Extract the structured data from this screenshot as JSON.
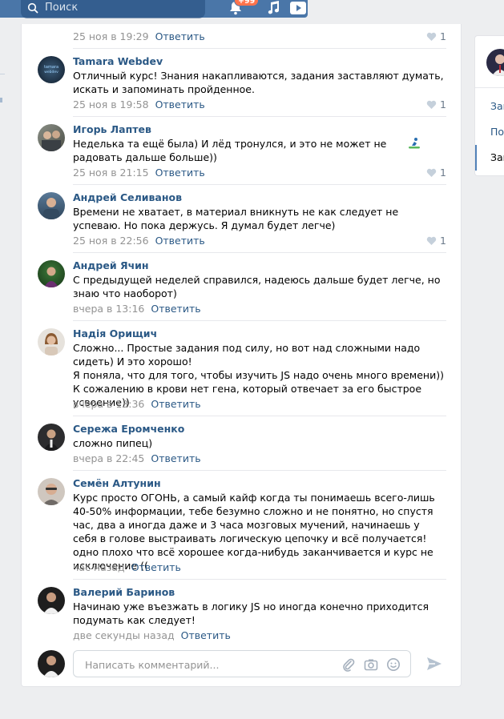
{
  "header": {
    "search_placeholder": "Поиск",
    "notif_badge": "+99"
  },
  "comments": [
    {
      "author": "",
      "text": "",
      "date": "25 ноя в 19:29",
      "reply": "Ответить",
      "likes": "1"
    },
    {
      "author": "Tamara Webdev",
      "text": "Отличный курс! Знания накапливаются, задания заставляют думать, искать и запоминать пройденное.",
      "date": "25 ноя в 19:58",
      "reply": "Ответить",
      "likes": "1"
    },
    {
      "author": "Игорь Лаптев",
      "text": "Неделька та ещё была) И лёд тронулся, и это не может не радовать дальше больше))",
      "date": "25 ноя в 21:15",
      "reply": "Ответить",
      "likes": "1"
    },
    {
      "author": "Андрей Селиванов",
      "text": "Времени не хватает, в материал вникнуть не как следует не успеваю. Но пока держусь. Я думал будет легче)",
      "date": "25 ноя в 22:56",
      "reply": "Ответить",
      "likes": "1"
    },
    {
      "author": "Андрей Ячин",
      "text": "С предыдущей неделей справился, надеюсь дальше будет легче, но знаю что наоборот)",
      "date": "вчера в 13:16",
      "reply": "Ответить",
      "likes": ""
    },
    {
      "author": "Надія Орищич",
      "text1": "Сложно... Простые задания под силу, но вот над сложными надо сидеть) И это хорошо!",
      "text2": "Я поняла, что для того, чтобы изучить JS надо очень много времени)) К сожалению в крови нет гена, который отвечает за его быстрое усвоение))",
      "date": "вчера в 13:36",
      "reply": "Ответить",
      "likes": ""
    },
    {
      "author": "Сережа Еромченко",
      "text": "сложно пипец)",
      "date": "вчера в 22:45",
      "reply": "Ответить",
      "likes": ""
    },
    {
      "author": "Семён Алтунин",
      "text": "Курс просто ОГОНЬ, а самый кайф когда ты понимаешь всего-лишь 40-50% информации, тебе безумно сложно и не понятно, но спустя час, два а иногда даже и 3 часа мозговых мучений, начинаешь у себя в голове выстраивать логическую цепочку и всё получается! одно плохо что всё хорошее когда-нибудь заканчивается и курс не исключение ((",
      "date": "час назад",
      "reply": "Ответить",
      "likes": ""
    },
    {
      "author": "Валерий Баринов",
      "text": "Начинаю уже въезжать в логику JS но иногда конечно приходится подумать как следует!",
      "date": "две секунды назад",
      "reply": "Ответить",
      "likes": ""
    }
  ],
  "composer": {
    "placeholder": "Написать комментарий..."
  },
  "side_panel": {
    "items": [
      "Зап",
      "По",
      "Зап"
    ]
  }
}
